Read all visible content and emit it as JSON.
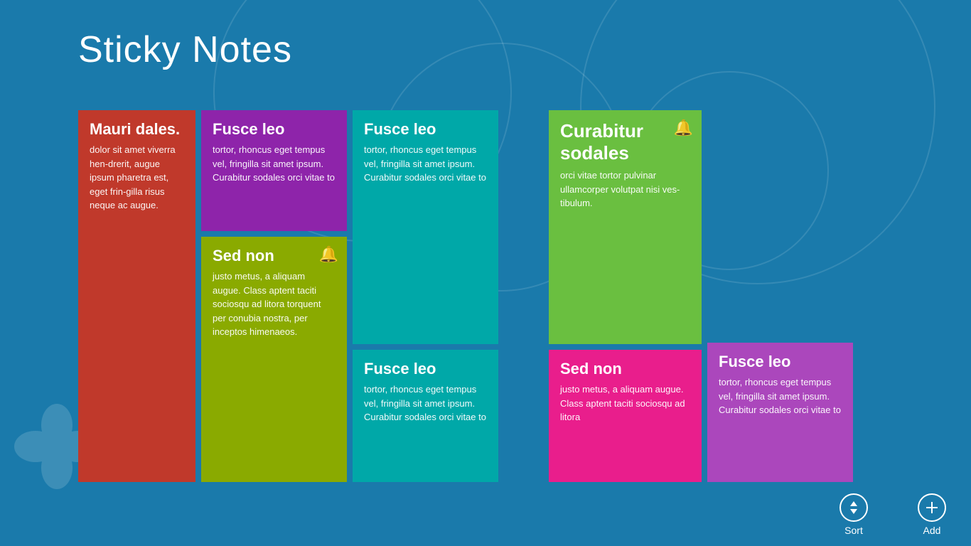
{
  "app": {
    "title": "Sticky Notes"
  },
  "colors": {
    "background": "#1a7aab",
    "red": "#c0392b",
    "purple": "#8e24aa",
    "teal": "#00a8a8",
    "olive": "#8aaa00",
    "green": "#6abf40",
    "pink": "#e91e8c",
    "magenta": "#ab47bc"
  },
  "notes": [
    {
      "id": "note1",
      "color": "red",
      "title": "Mauri dales.",
      "body": "dolor sit amet viverra hen-drerit, augue ipsum pharetra est, eget frin-gilla risus neque ac augue.",
      "bell": false,
      "size": "tall"
    },
    {
      "id": "note2",
      "color": "purple",
      "title": "Fusce leo",
      "body": "tortor, rhoncus eget tempus vel, fringilla sit amet ipsum. Curabitur sodales orci vitae to",
      "bell": false,
      "size": "small"
    },
    {
      "id": "note3",
      "color": "olive",
      "title": "Sed non",
      "body": "justo metus, a aliquam augue. Class aptent taciti sociosqu ad litora torquent per conubia nostra, per inceptos himenaeos.",
      "bell": true,
      "size": "large"
    },
    {
      "id": "note4",
      "color": "teal",
      "title": "Fusce leo",
      "body": "tortor, rhoncus eget tempus vel, fringilla sit amet ipsum. Curabitur sodales orci vitae to",
      "bell": false,
      "size": "tall"
    },
    {
      "id": "note5",
      "color": "teal",
      "title": "Fusce leo",
      "body": "tortor, rhoncus eget tempus vel, fringilla sit amet ipsum. Curabitur sodales orci vitae to",
      "bell": false,
      "size": "small"
    },
    {
      "id": "note6",
      "color": "green",
      "title": "Curabitur sodales",
      "body": "orci vitae tortor pulvinar ullamcorper volutpat nisi ves-tibulum.",
      "bell": true,
      "size": "large"
    },
    {
      "id": "note7",
      "color": "pink",
      "title": "Sed non",
      "body": "justo metus, a aliquam augue. Class aptent taciti sociosqu ad litora",
      "bell": false,
      "size": "small"
    },
    {
      "id": "note8",
      "color": "magenta",
      "title": "Fusce leo",
      "body": "tortor, rhoncus eget tempus vel, fringilla sit amet ipsum. Curabitur sodales orci vitae to",
      "bell": false,
      "size": "small"
    }
  ],
  "toolbar": {
    "sort_label": "Sort",
    "add_label": "Add"
  }
}
